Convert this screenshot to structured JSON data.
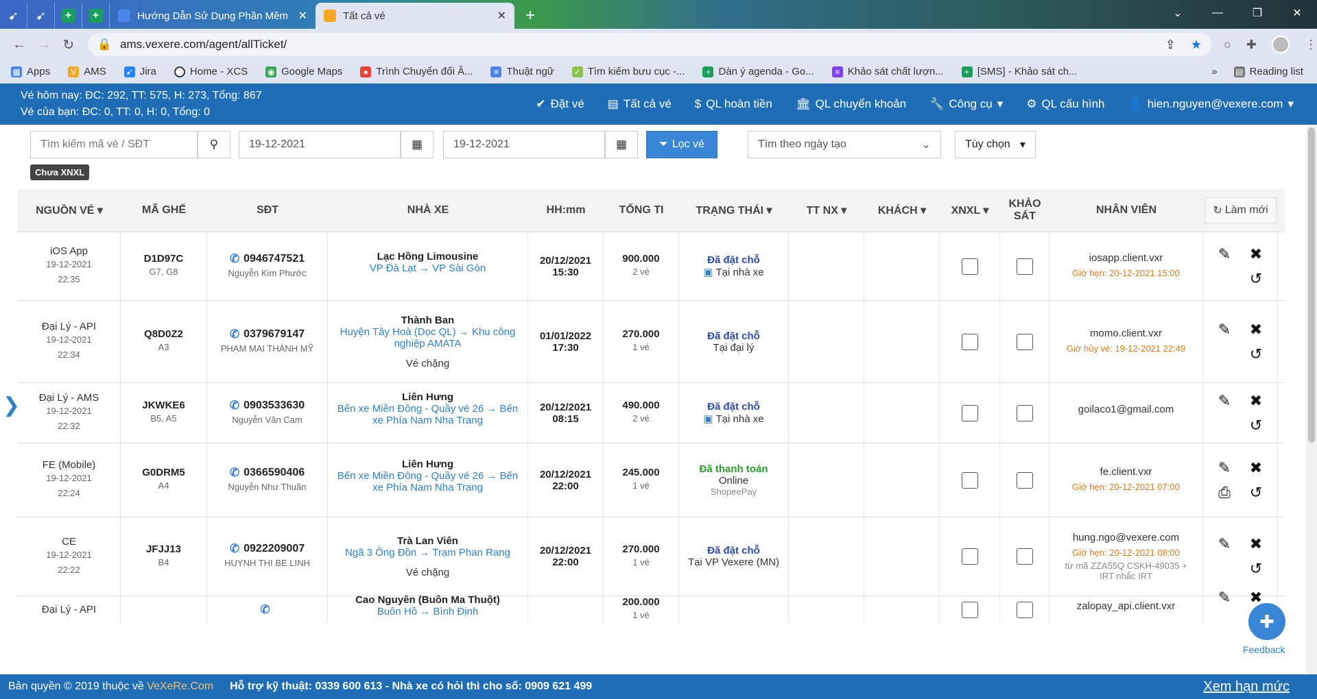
{
  "browser": {
    "tabs": [
      {
        "label": "Hướng Dẫn Sử Dụng Phần Mềm"
      },
      {
        "label": "Tất cả vé"
      }
    ],
    "url": "ams.vexere.com/agent/allTicket/",
    "bookmarks": [
      "Apps",
      "AMS",
      "Jira",
      "Home - XCS",
      "Google Maps",
      "Trình Chuyển đổi Â...",
      "Thuật ngữ",
      "Tìm kiếm bưu cục -...",
      "Dàn ý agenda - Go...",
      "Khảo sát chất lượn...",
      "[SMS] - Khảo sát ch..."
    ],
    "reading_list": "Reading list"
  },
  "header": {
    "stats1": "Vé hôm nay: ĐC: 292, TT: 575, H: 273, Tổng: 867",
    "stats2": "Vé của bạn: ĐC: 0, TT: 0, H: 0, Tổng: 0",
    "menu": [
      "Đặt vé",
      "Tất cả vé",
      "QL hoàn tiền",
      "QL chuyển khoản",
      "Công cụ",
      "QL cấu hình",
      "hien.nguyen@vexere.com"
    ]
  },
  "filters": {
    "search_placeholder": "Tìm kiếm mã vé / SĐT",
    "date_from": "19-12-2021",
    "date_to": "19-12-2021",
    "filter_btn": "Lọc vé",
    "date_type": "Tìm theo ngày tạo",
    "options": "Tùy chọn",
    "badge": "Chưa XNXL"
  },
  "table": {
    "headers": [
      "NGUỒN VÉ",
      "MÃ GHẾ",
      "SĐT",
      "NHÀ XE",
      "HH:mm",
      "TỔNG TI",
      "TRẠNG THÁI",
      "TT NX",
      "KHÁCH",
      "XNXL",
      "KHẢO SÁT",
      "NHÂN VIÊN"
    ],
    "refresh": "Làm mới",
    "rows": [
      {
        "source": "iOS App",
        "date": "19-12-2021",
        "time": "22:35",
        "code": "D1D97C",
        "seats": "G7, G8",
        "phone": "0946747521",
        "name": "Nguyễn Kim Phước",
        "operator": "Lạc Hồng Limousine",
        "route": "VP Đà Lạt → VP Sài Gòn",
        "note": "",
        "dep_date": "20/12/2021",
        "dep_time": "15:30",
        "total": "900.000",
        "qty": "2 vé",
        "status": "Đã đặt chỗ",
        "pay": "Tại nhà xe",
        "pay2": "",
        "staff": "iosapp.client.vxr",
        "staff_note": "Giờ hẹn: 20-12-2021 15:00",
        "staff_note2": ""
      },
      {
        "source": "Đại Lý - API",
        "date": "19-12-2021",
        "time": "22:34",
        "code": "Q8D0Z2",
        "seats": "A3",
        "phone": "0379679147",
        "name": "PHẠM MAI THÀNH MỸ",
        "operator": "Thành Ban",
        "route": "Huyện Tây Hoà (Dọc QL) → Khu công nghiệp AMATA",
        "note": "Vé chặng",
        "dep_date": "01/01/2022",
        "dep_time": "17:30",
        "total": "270.000",
        "qty": "1 vé",
        "status": "Đã đặt chỗ",
        "pay": "Tại đại lý",
        "pay2": "",
        "staff": "momo.client.vxr",
        "staff_note": "Giờ hủy vé: 19-12-2021 22:49",
        "staff_note2": ""
      },
      {
        "source": "Đại Lý - AMS",
        "date": "19-12-2021",
        "time": "22:32",
        "code": "JKWKE6",
        "seats": "B5, A5",
        "phone": "0903533630",
        "name": "Nguyễn Văn Cam",
        "operator": "Liên Hưng",
        "route": "Bến xe Miền Đông - Quầy vé 26 → Bến xe Phía Nam Nha Trang",
        "note": "",
        "dep_date": "20/12/2021",
        "dep_time": "08:15",
        "total": "490.000",
        "qty": "2 vé",
        "status": "Đã đặt chỗ",
        "pay": "Tại nhà xe",
        "pay2": "",
        "staff": "goilaco1@gmail.com",
        "staff_note": "",
        "staff_note2": ""
      },
      {
        "source": "FE (Mobile)",
        "date": "19-12-2021",
        "time": "22:24",
        "code": "G0DRM5",
        "seats": "A4",
        "phone": "0366590406",
        "name": "Nguyễn Như Thuần",
        "operator": "Liên Hưng",
        "route": "Bến xe Miền Đông - Quầy vé 26 → Bến xe Phía Nam Nha Trang",
        "note": "",
        "dep_date": "20/12/2021",
        "dep_time": "22:00",
        "total": "245.000",
        "qty": "1 vé",
        "status": "Đã thanh toán",
        "pay": "Online",
        "pay2": "ShopeePay",
        "staff": "fe.client.vxr",
        "staff_note": "Giờ hẹn: 20-12-2021 07:00",
        "staff_note2": ""
      },
      {
        "source": "CE",
        "date": "19-12-2021",
        "time": "22:22",
        "code": "JFJJ13",
        "seats": "B4",
        "phone": "0922209007",
        "name": "HUYNH THI BE LINH",
        "operator": "Trà Lan Viên",
        "route": "Ngã 3 Ông Đồn → Trạm Phan Rang",
        "note": "Vé chặng",
        "dep_date": "20/12/2021",
        "dep_time": "22:00",
        "total": "270.000",
        "qty": "1 vé",
        "status": "Đã đặt chỗ",
        "pay": "Tại VP Vexere (MN)",
        "pay2": "",
        "staff": "hung.ngo@vexere.com",
        "staff_note": "Giờ hẹn: 20-12-2021 08:00",
        "staff_note2": "từ mã ZZA55Q CSKH-49035 + IRT nhắc IRT"
      },
      {
        "source": "Đại Lý - API",
        "date": "",
        "time": "",
        "code": "",
        "seats": "",
        "phone": "",
        "name": "",
        "operator": "Cao Nguyên (Buôn Ma Thuột)",
        "route": "Buôn Hồ → Bình Định",
        "note": "",
        "dep_date": "",
        "dep_time": "",
        "total": "200.000",
        "qty": "1 vé",
        "status": "",
        "pay": "",
        "pay2": "",
        "staff": "zalopay_api.client.vxr",
        "staff_note": "",
        "staff_note2": ""
      }
    ]
  },
  "footer": {
    "copyright": "Bản quyền © 2019 thuộc về",
    "brand": "VeXeRe.Com",
    "support": "Hỗ trợ kỹ thuật: 0339 600 613 - Nhà xe có hỏi thì cho số: 0909 621 499",
    "limit": "Xem hạn mức"
  },
  "feedback": "Feedback"
}
